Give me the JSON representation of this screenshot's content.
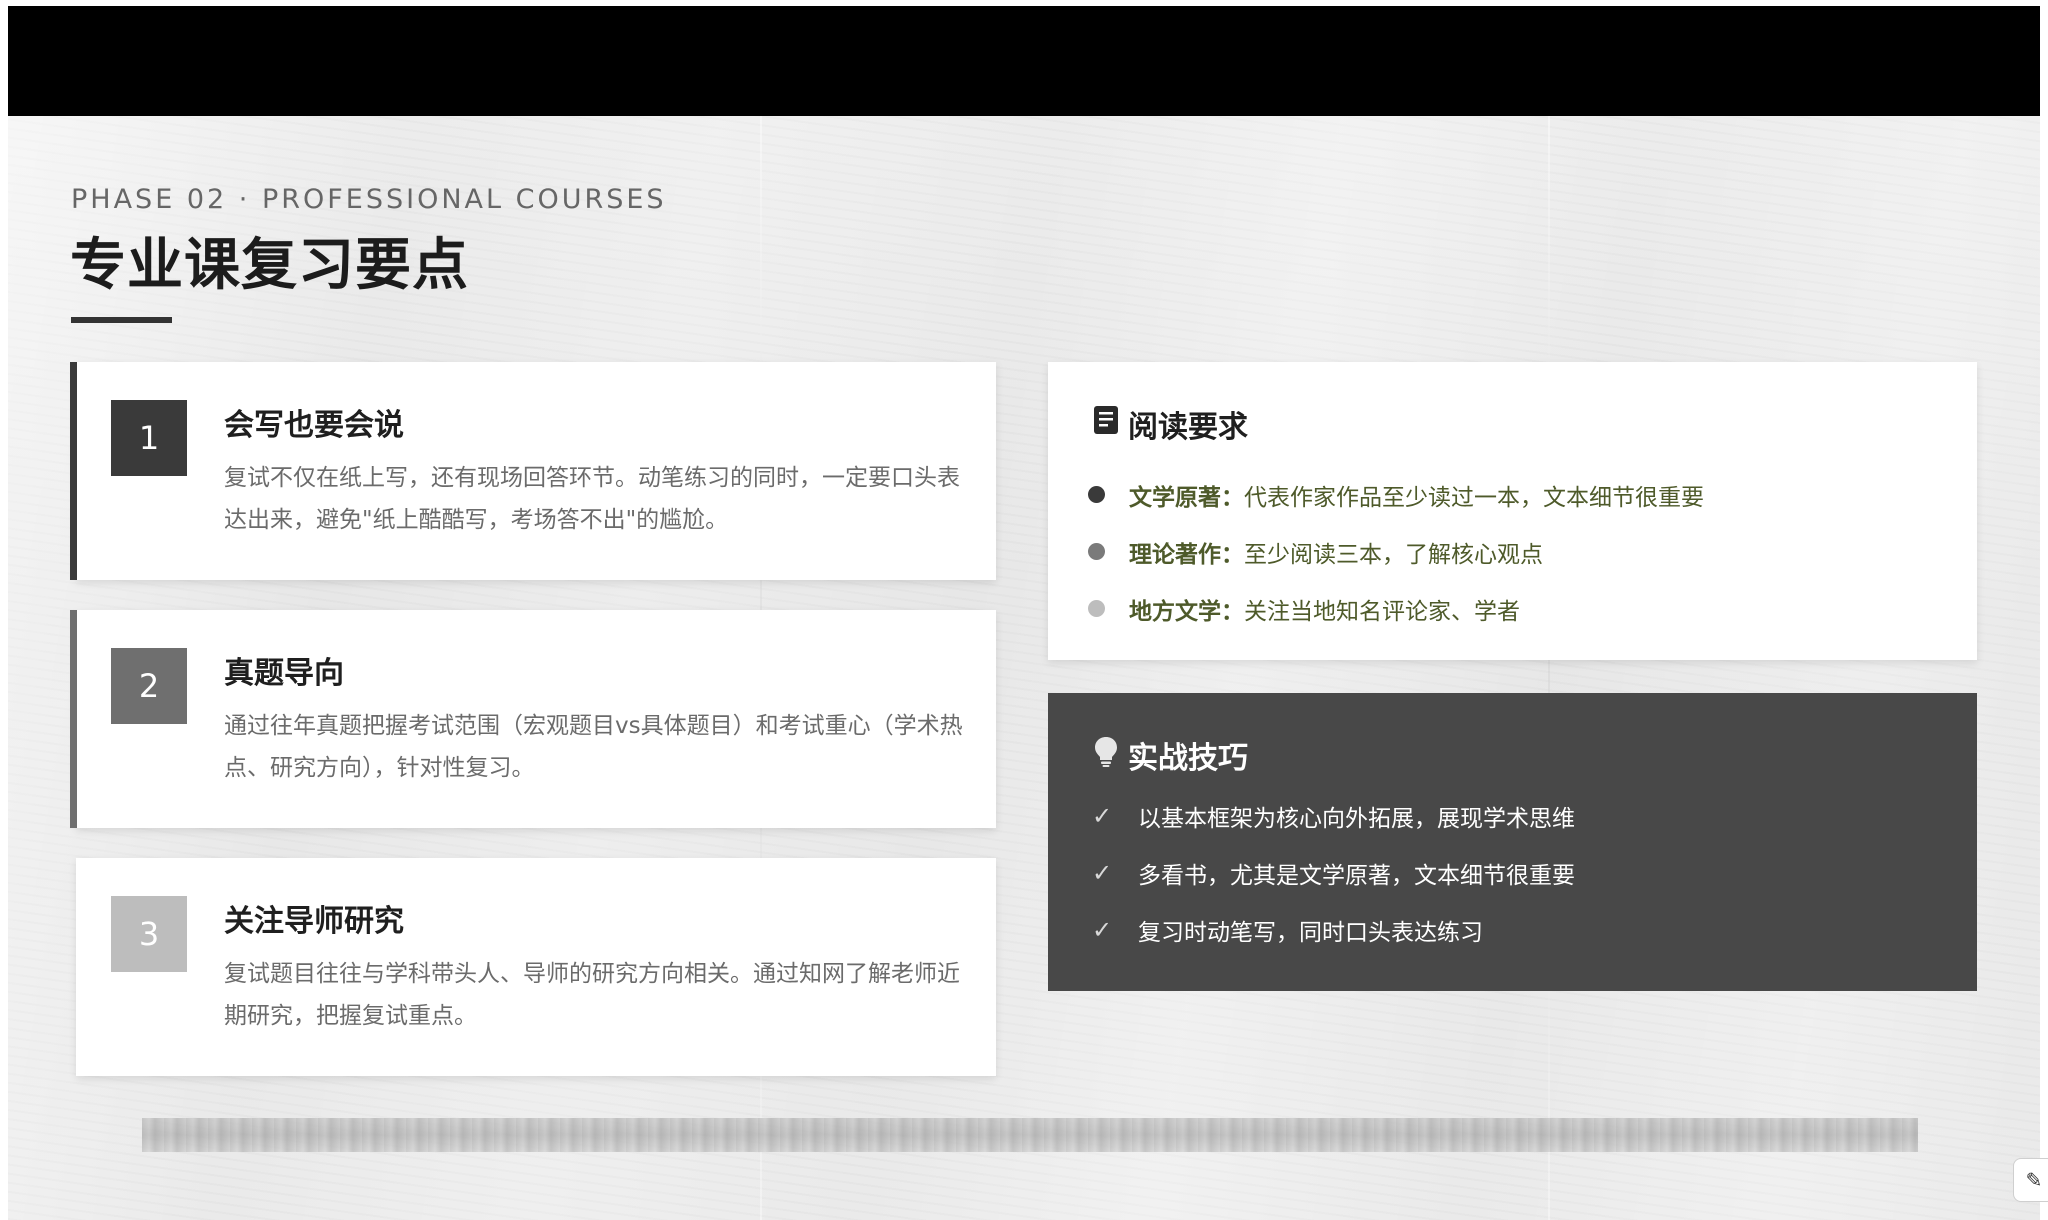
{
  "slide": {
    "phase_label": "PHASE 02 · PROFESSIONAL COURSES",
    "title": "专业课复习要点"
  },
  "cards": [
    {
      "number": "1",
      "title": "会写也要会说",
      "body": "复试不仅在纸上写，还有现场回答环节。动笔练习的同时，一定要口头表达出来，避免\"纸上酷酷写，考场答不出\"的尴尬。",
      "color": "#3a3a3a"
    },
    {
      "number": "2",
      "title": "真题导向",
      "body": "通过往年真题把握考试范围（宏观题目vs具体题目）和考试重心（学术热点、研究方向），针对性复习。",
      "color": "#6f6f6f"
    },
    {
      "number": "3",
      "title": "关注导师研究",
      "body": "复试题目往往与学科带头人、导师的研究方向相关。通过知网了解老师近期研究，把握复试重点。",
      "color": "#bdbdbd"
    }
  ],
  "reading": {
    "icon": "book-icon",
    "title": "阅读要求",
    "items": [
      {
        "label": "文学原著：",
        "text": "代表作家作品至少读过一本，文本细节很重要",
        "dot_color": "#3a3a3a"
      },
      {
        "label": "理论著作：",
        "text": "至少阅读三本，了解核心观点",
        "dot_color": "#7a7a7a"
      },
      {
        "label": "地方文学：",
        "text": "关注当地知名评论家、学者",
        "dot_color": "#bdbdbd"
      }
    ]
  },
  "tips": {
    "icon": "lightbulb-icon",
    "title": "实战技巧",
    "items": [
      "以基本框架为核心向外拓展，展现学术思维",
      "多看书，尤其是文学原著，文本细节很重要",
      "复习时动笔写，同时口头表达练习"
    ]
  },
  "colors": {
    "dark_panel": "#484848",
    "olive_text": "#4e5a2a"
  }
}
